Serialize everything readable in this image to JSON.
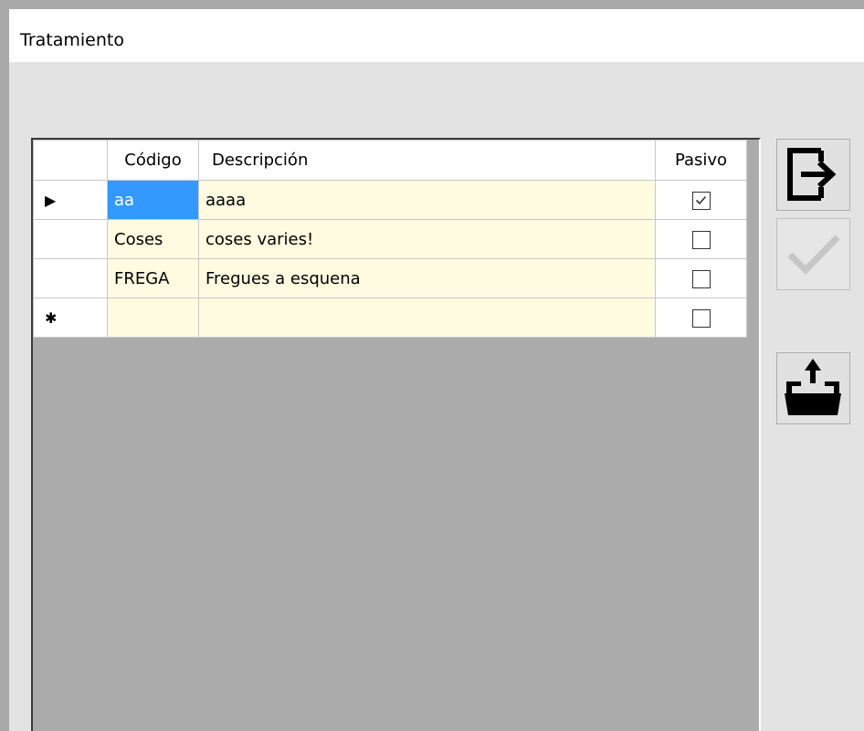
{
  "window": {
    "title": "Tratamiento"
  },
  "grid": {
    "columns": [
      "",
      "Código",
      "Descripción",
      "Pasivo"
    ],
    "rows": [
      {
        "indicator": "▶",
        "codigo": "aa",
        "descripcion": "aaaa",
        "pasivo": true,
        "selected_cell": "codigo"
      },
      {
        "indicator": "",
        "codigo": "Coses",
        "descripcion": "coses varies!",
        "pasivo": false
      },
      {
        "indicator": "",
        "codigo": "FREGA",
        "descripcion": "Fregues a esquena",
        "pasivo": false
      },
      {
        "indicator": "✱",
        "codigo": "",
        "descripcion": "",
        "pasivo": false
      }
    ]
  },
  "buttons": {
    "exit": {
      "icon": "exit-arrow-icon"
    },
    "accept": {
      "icon": "checkmark-icon",
      "enabled": false
    },
    "export": {
      "icon": "folder-upload-icon"
    }
  },
  "colors": {
    "selection": "#3399ff",
    "cell_background": "#fffbe1",
    "grid_background": "#ababab"
  }
}
